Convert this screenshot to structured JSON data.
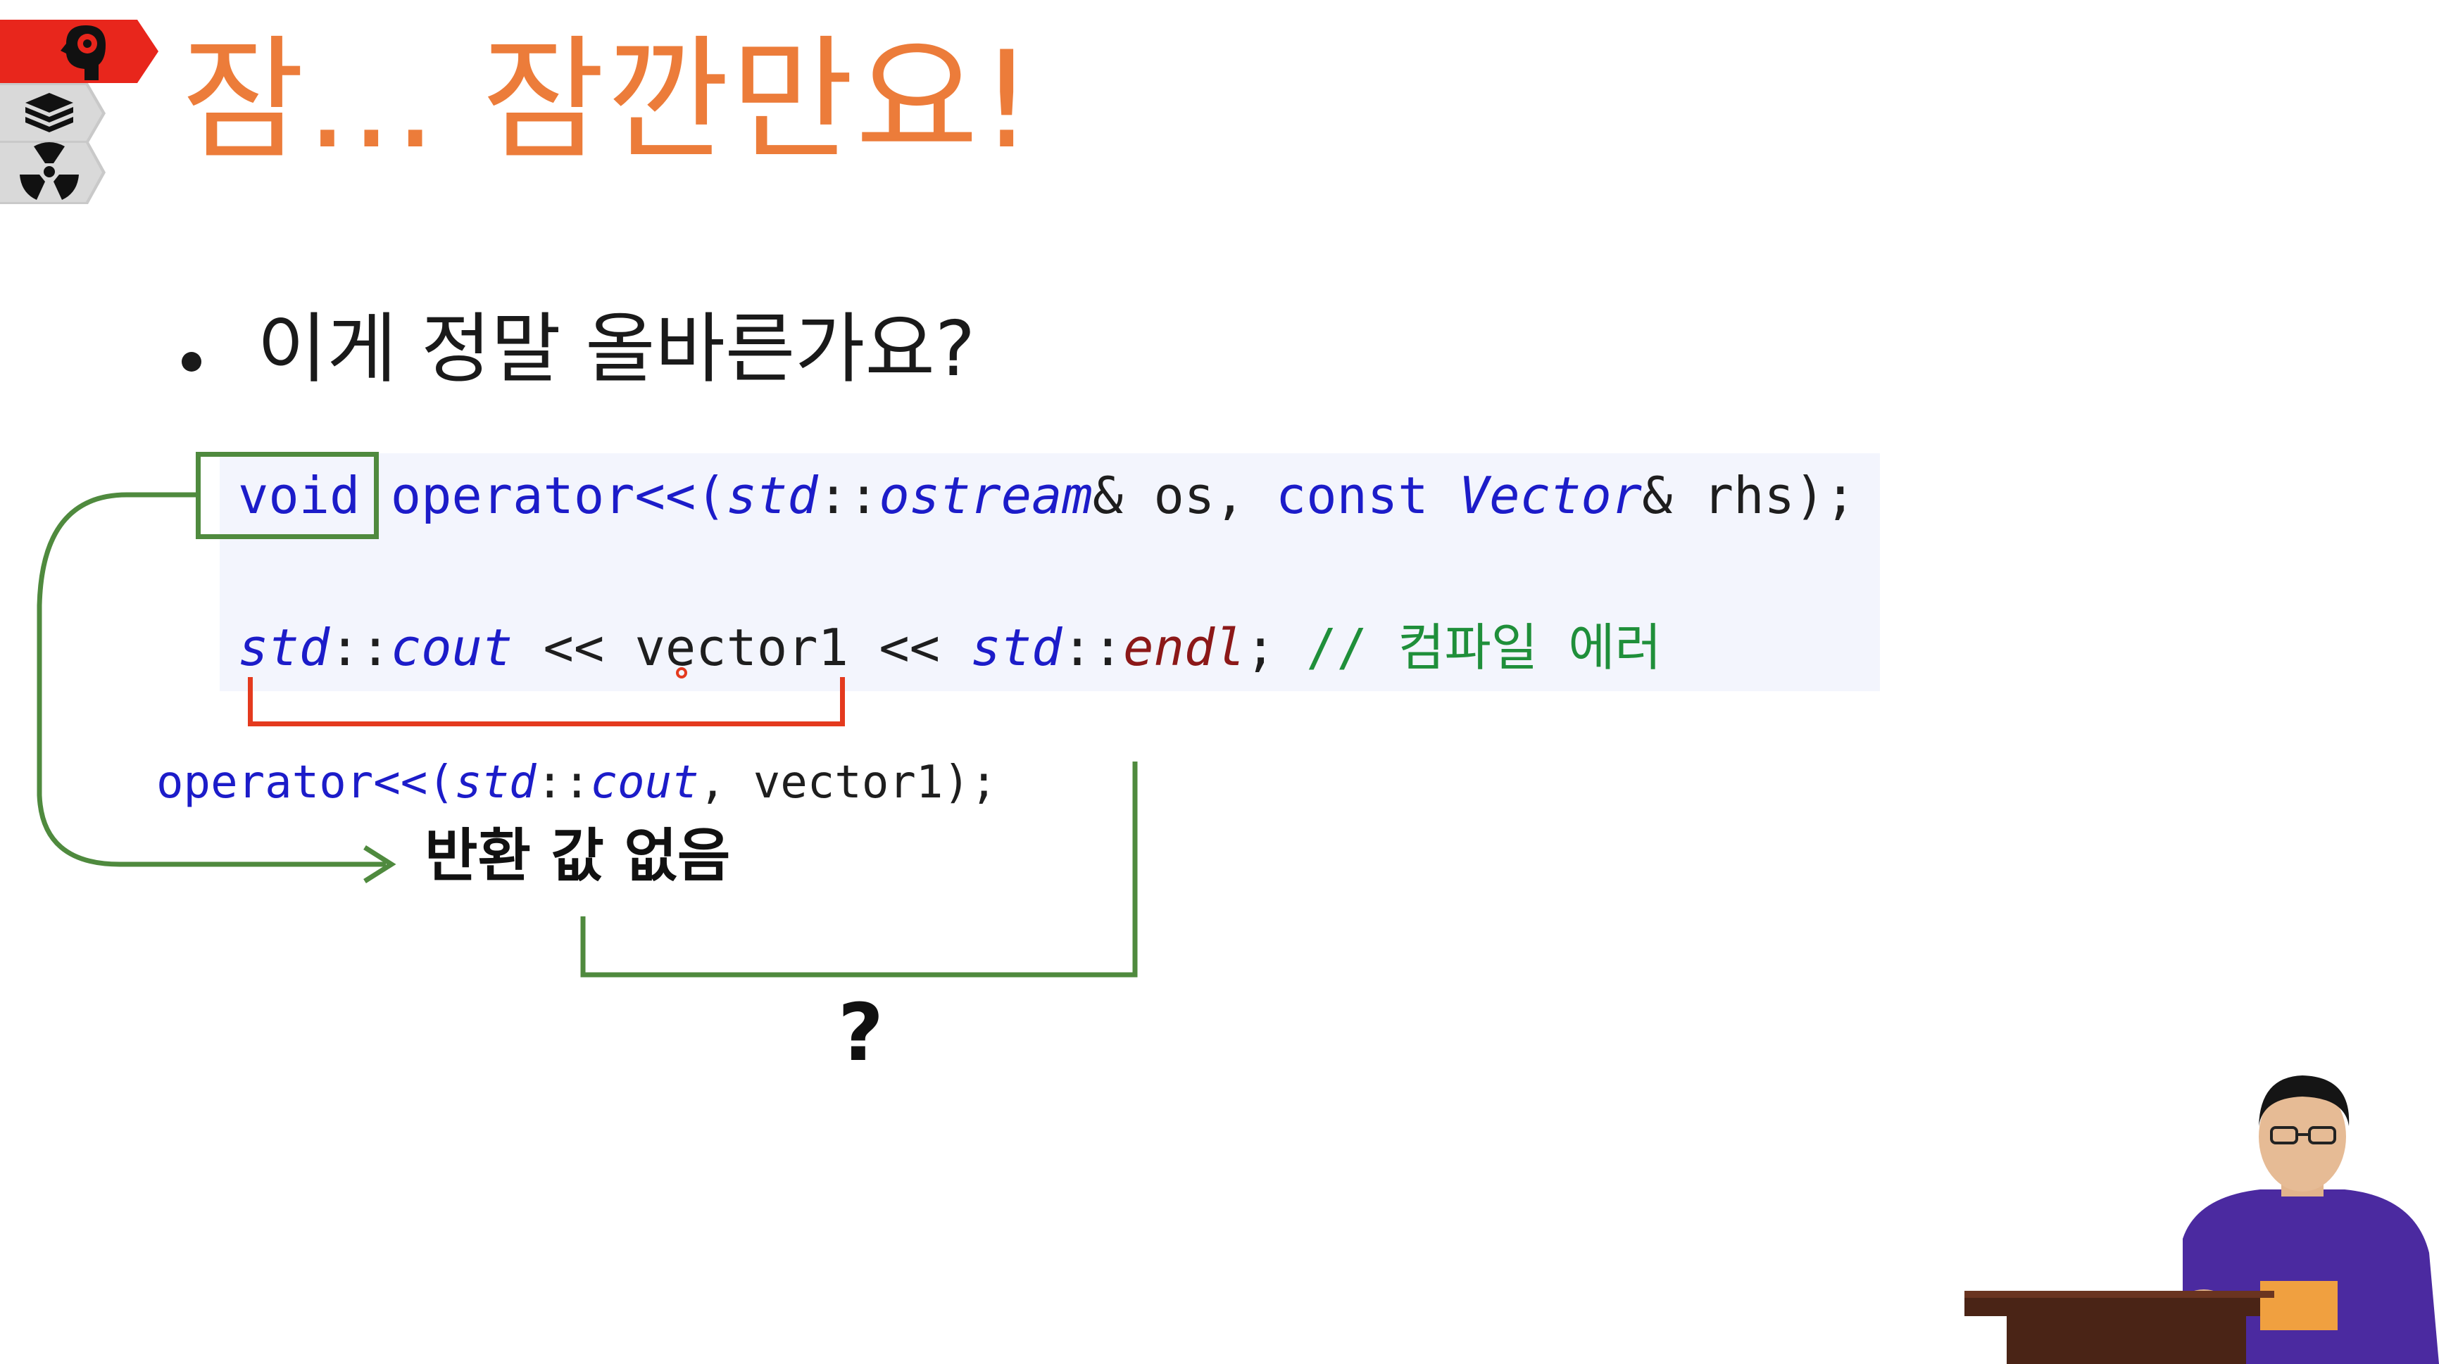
{
  "slide": {
    "title": "잠... 잠깐만요!",
    "bullet": "이게 정말 올바른가요?"
  },
  "code": {
    "line1": {
      "kw_void": "void",
      "fn": " operator<<(",
      "ns1": "std",
      "sep1": "::",
      "t1": "ostream",
      "p1": "& os, ",
      "kw_const": "const",
      "sp": " ",
      "t2": "Vector",
      "p2": "& rhs);"
    },
    "line2": {
      "ns": "std",
      "sep": "::",
      "cout": "cout",
      "mid": " << vector1 << ",
      "ns2": "std",
      "sep2": "::",
      "endl": "endl",
      "semi": "; ",
      "comment": "// 컴파일 에러"
    },
    "line3": {
      "fn": "operator<<(",
      "ns": "std",
      "sep": "::",
      "cout": "cout",
      "rest": ", vector1);"
    }
  },
  "annotations": {
    "no_return": "반환 값 없음",
    "question": "?"
  },
  "nav": {
    "tab1_icon": "brain-head-icon",
    "tab2_icon": "layers-icon",
    "tab3_icon": "radiation-icon"
  },
  "colors": {
    "title": "#ec7c3a",
    "keyword": "#1c1cc9",
    "comment": "#1f8f3a",
    "endl": "#8c1818",
    "green_annotation": "#4f8a3e",
    "red_annotation": "#e43a1e",
    "nav_active": "#e8261c",
    "nav_inactive": "#c8c8c8"
  }
}
